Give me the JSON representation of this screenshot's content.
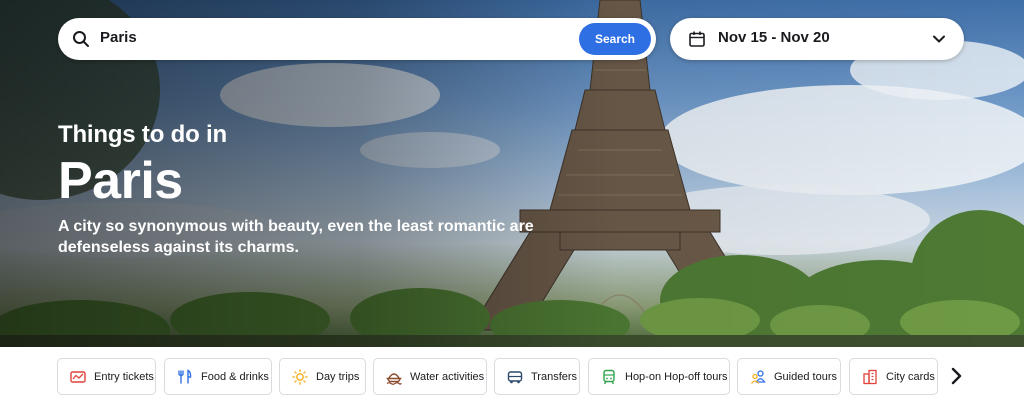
{
  "search": {
    "value": "Paris",
    "button_label": "Search",
    "icon": "search-icon"
  },
  "dates": {
    "value": "Nov 15 - Nov 20",
    "icon": "calendar-icon"
  },
  "hero": {
    "eyebrow": "Things to do in",
    "city": "Paris",
    "tagline": "A city so synonymous with beauty, even the least romantic are defenseless against its charms."
  },
  "categories": [
    {
      "label": "Entry tickets",
      "icon": "ticket-icon",
      "color": "#e0443a"
    },
    {
      "label": "Food & drinks",
      "icon": "fork-knife-icon",
      "color": "#2f6fe4"
    },
    {
      "label": "Day trips",
      "icon": "sun-icon",
      "color": "#f2b01e"
    },
    {
      "label": "Water activities",
      "icon": "boat-icon",
      "color": "#8a4a2a"
    },
    {
      "label": "Transfers",
      "icon": "bus-icon",
      "color": "#2d4a6a"
    },
    {
      "label": "Hop-on Hop-off tours",
      "icon": "tram-icon",
      "color": "#2fa24a"
    },
    {
      "label": "Guided tours",
      "icon": "people-icon",
      "color": "#2f6fe4"
    },
    {
      "label": "City cards",
      "icon": "city-icon",
      "color": "#e0443a"
    }
  ],
  "colors": {
    "accent": "#2f6fe4",
    "text": "#1a1b1f",
    "chip_border": "#d9dbe0"
  }
}
